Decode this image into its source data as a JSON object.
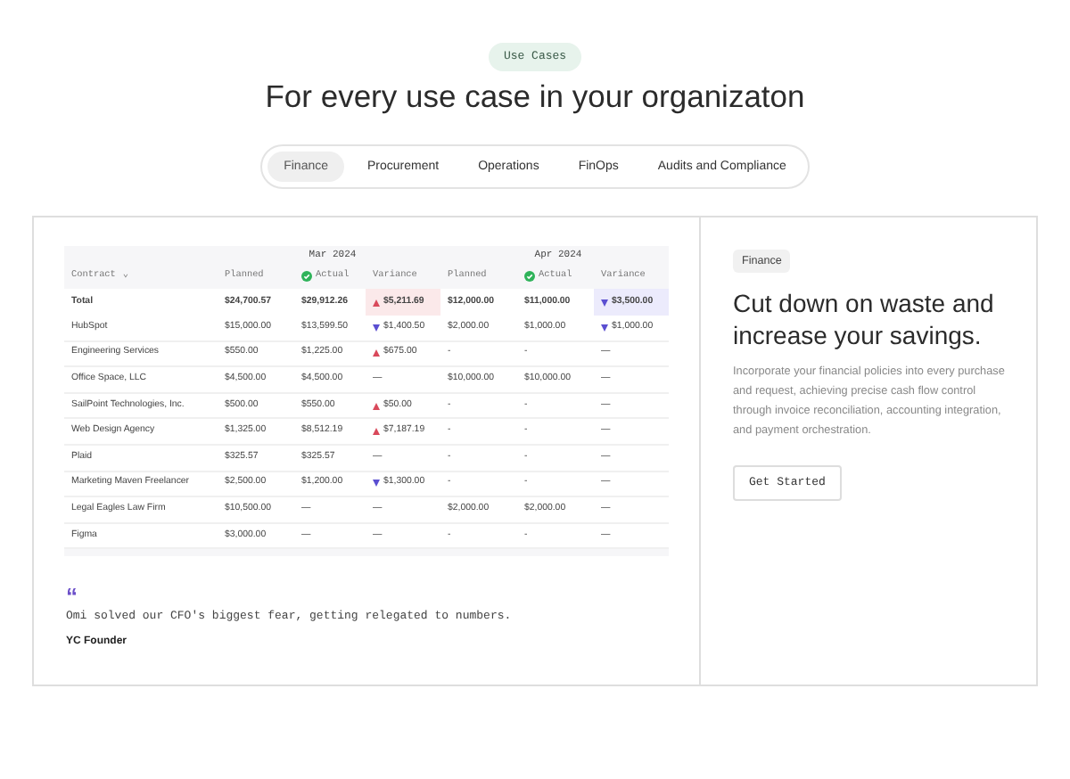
{
  "badge": "Use Cases",
  "title": "For every use case in your organizaton",
  "tabs": [
    {
      "label": "Finance",
      "selected": true
    },
    {
      "label": "Procurement",
      "selected": false
    },
    {
      "label": "Operations",
      "selected": false
    },
    {
      "label": "FinOps",
      "selected": false
    },
    {
      "label": "Audits and Compliance",
      "selected": false
    }
  ],
  "table": {
    "months": [
      "Mar 2024",
      "Apr 2024"
    ],
    "columns": [
      "Contract",
      "Planned",
      "Actual",
      "Variance",
      "Planned",
      "Actual",
      "Variance"
    ],
    "sort_indicator": "⌄",
    "total": {
      "cells": [
        "Total",
        "$24,700.57",
        "$29,912.26",
        {
          "text": "$5,211.69",
          "kind": "increase"
        },
        "$12,000.00",
        "$11,000.00",
        {
          "text": "$3,500.00",
          "kind": "decrease"
        }
      ]
    },
    "rows": [
      {
        "cells": [
          "HubSpot",
          "$15,000.00",
          "$13,599.50",
          {
            "text": "$1,400.50",
            "kind": "decrease"
          },
          "$2,000.00",
          "$1,000.00",
          {
            "text": "$1,000.00",
            "kind": "decrease"
          }
        ]
      },
      {
        "cells": [
          "Engineering Services",
          "$550.00",
          "$1,225.00",
          {
            "text": "$675.00",
            "kind": "increase"
          },
          "-",
          "-",
          {
            "text": "—",
            "kind": "flat"
          }
        ]
      },
      {
        "cells": [
          "Office Space, LLC",
          "$4,500.00",
          "$4,500.00",
          {
            "text": "—",
            "kind": "flat"
          },
          "$10,000.00",
          "$10,000.00",
          {
            "text": "—",
            "kind": "flat"
          }
        ]
      },
      {
        "cells": [
          "SailPoint Technologies, Inc.",
          "$500.00",
          "$550.00",
          {
            "text": "$50.00",
            "kind": "increase"
          },
          "-",
          "-",
          {
            "text": "—",
            "kind": "flat"
          }
        ]
      },
      {
        "cells": [
          "Web Design Agency",
          "$1,325.00",
          "$8,512.19",
          {
            "text": "$7,187.19",
            "kind": "increase"
          },
          "-",
          "-",
          {
            "text": "—",
            "kind": "flat"
          }
        ]
      },
      {
        "cells": [
          "Plaid",
          "$325.57",
          "$325.57",
          {
            "text": "—",
            "kind": "flat"
          },
          "-",
          "-",
          {
            "text": "—",
            "kind": "flat"
          }
        ]
      },
      {
        "cells": [
          "Marketing Maven Freelancer",
          "$2,500.00",
          "$1,200.00",
          {
            "text": "$1,300.00",
            "kind": "decrease"
          },
          "-",
          "-",
          {
            "text": "—",
            "kind": "flat"
          }
        ]
      },
      {
        "cells": [
          "Legal Eagles Law Firm",
          "$10,500.00",
          "—",
          {
            "text": "—",
            "kind": "flat"
          },
          "$2,000.00",
          "$2,000.00",
          {
            "text": "—",
            "kind": "flat"
          }
        ]
      },
      {
        "cells": [
          "Figma",
          "$3,000.00",
          "—",
          {
            "text": "—",
            "kind": "flat"
          },
          "-",
          "-",
          {
            "text": "—",
            "kind": "flat"
          }
        ]
      }
    ]
  },
  "quote": {
    "mark": "“",
    "text": "Omi solved our CFO's biggest fear, getting relegated to numbers.",
    "author": "YC Founder"
  },
  "panel": {
    "tag": "Finance",
    "heading": "Cut down on waste and increase your savings.",
    "body": "Incorporate your financial policies into every purchase and request, achieving precise cash flow control through invoice reconciliation, accounting integration, and payment orchestration.",
    "button": "Get Started"
  }
}
